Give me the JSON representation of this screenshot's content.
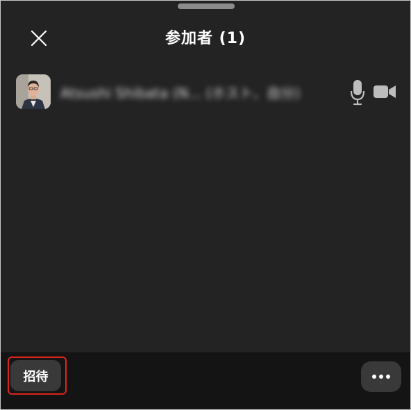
{
  "header": {
    "title": "参加者 (1)",
    "close_icon": "close-icon"
  },
  "participants": [
    {
      "name": "Atsushi Shibata (N... (ホスト、自分)",
      "avatar_icon": "user-photo",
      "mic_icon": "microphone-icon",
      "video_icon": "video-camera-icon"
    }
  ],
  "footer": {
    "invite_label": "招待",
    "more_icon": "more-horizontal-icon"
  },
  "colors": {
    "background": "#232323",
    "footer_background": "#141414",
    "button_background": "#393939",
    "highlight": "#d9241c",
    "icon": "#bdbdbd"
  }
}
